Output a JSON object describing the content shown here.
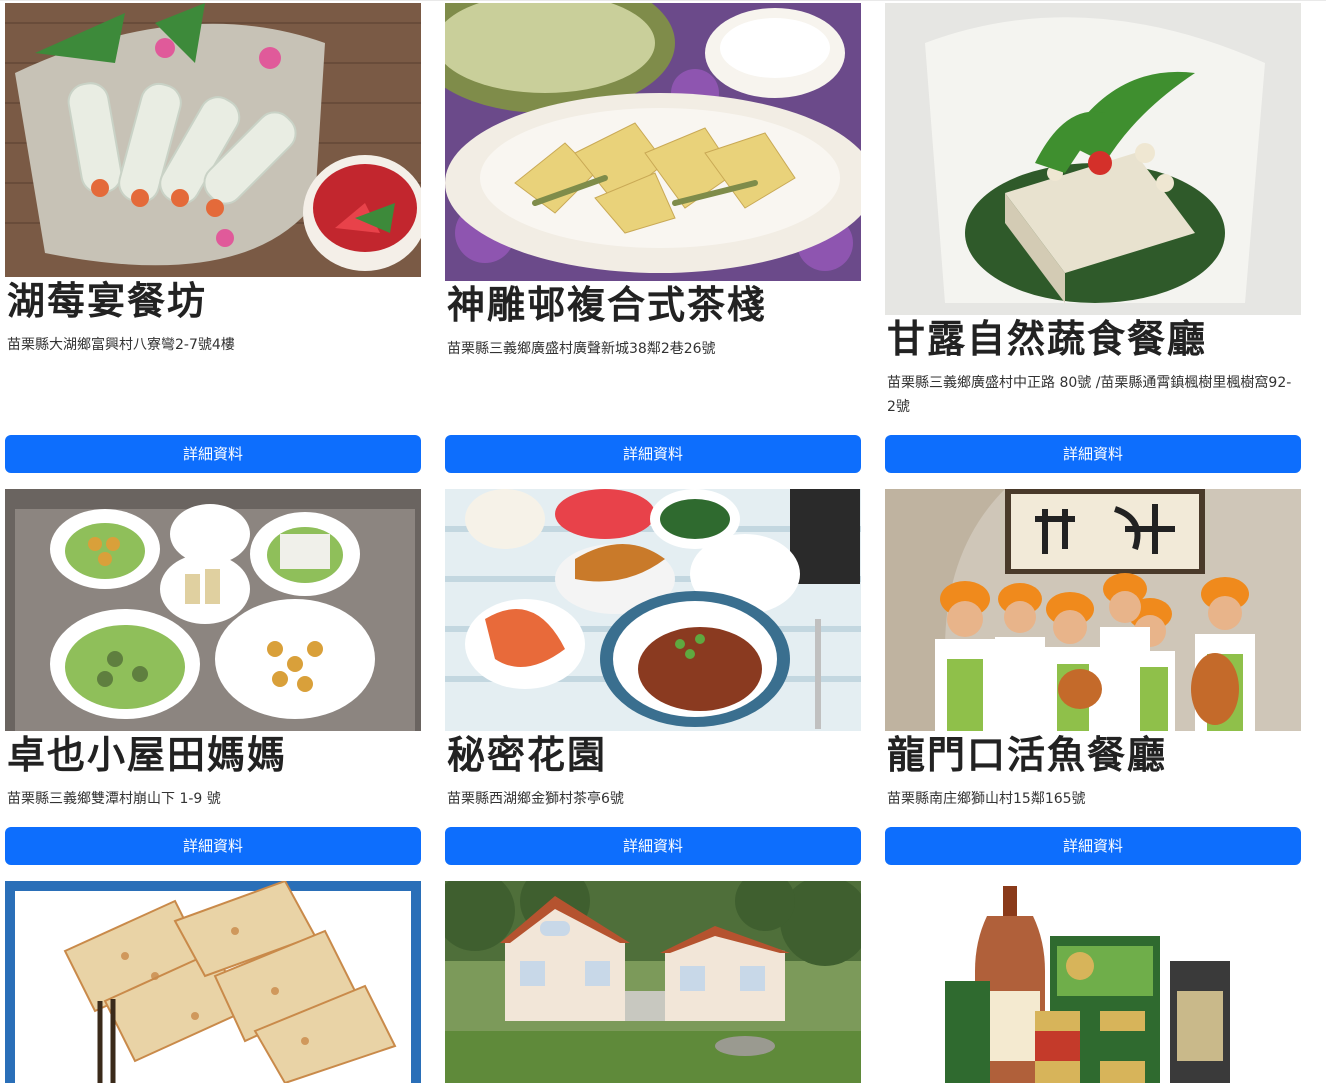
{
  "cards": [
    {
      "name": "湖莓宴餐坊",
      "address": "苗栗縣大湖鄉富興村八寮彎2-7號4樓",
      "button": "詳細資料",
      "image": "shrimp-spring-rolls-photo",
      "palette": [
        "#7a5a45",
        "#c7c2b6",
        "#e9ede3",
        "#e46a3a",
        "#3d8a3a",
        "#c2262e"
      ]
    },
    {
      "name": "神雕邨複合式茶棧",
      "address": "苗栗縣三義鄉廣盛村廣聲新城38鄰2巷26號",
      "button": "詳細資料",
      "image": "bamboo-shoot-salad-photo",
      "palette": [
        "#6b4a8a",
        "#f2ede4",
        "#e9d27a",
        "#7f8c4a",
        "#d8b66a",
        "#9c5ac0"
      ]
    },
    {
      "name": "甘露自然蔬食餐廳",
      "address": "苗栗縣三義鄉廣盛村中正路 80號 /苗栗縣通霄鎮楓樹里楓樹窩92-2號",
      "button": "詳細資料",
      "image": "tofu-dish-photo",
      "palette": [
        "#dcdcdc",
        "#f4f4f0",
        "#2f5a2a",
        "#e8e2cf",
        "#3f8f2f",
        "#d4302a"
      ]
    },
    {
      "name": "卓也小屋田媽媽",
      "address": "苗栗縣三義鄉雙潭村崩山下 1-9 號",
      "button": "詳細資料",
      "image": "vegetarian-banquet-photo",
      "palette": [
        "#6a6460",
        "#ffffff",
        "#8fbf5a",
        "#d9a03a",
        "#5f7f3f",
        "#e0d0a0"
      ]
    },
    {
      "name": "秘密花園",
      "address": "苗栗縣西湖鄉金獅村茶亭6號",
      "button": "詳細資料",
      "image": "set-meal-photo",
      "palette": [
        "#e4eef2",
        "#8a3a20",
        "#e86a3a",
        "#ffffff",
        "#3a6f8f",
        "#2f6a2f"
      ]
    },
    {
      "name": "龍門口活魚餐廳",
      "address": "苗栗縣南庄鄉獅山村15鄰165號",
      "button": "詳細資料",
      "image": "staff-group-photo",
      "palette": [
        "#cfc6b8",
        "#f08a1c",
        "#ffffff",
        "#8fc04a",
        "#c46a2a",
        "#4a3a2a"
      ]
    },
    {
      "name": "",
      "address": "",
      "button": "",
      "image": "radish-cake-photo",
      "palette": [
        "#2a6fb8",
        "#ffffff",
        "#e9d3a6",
        "#c98a4a",
        "#f5ead3",
        "#3a2a1a"
      ]
    },
    {
      "name": "",
      "address": "",
      "button": "",
      "image": "farmhouse-building-photo",
      "palette": [
        "#4f6f3a",
        "#f2e6d8",
        "#b5532f",
        "#7c9a5a",
        "#c8c8c0",
        "#7a8a9a"
      ]
    },
    {
      "name": "",
      "address": "",
      "button": "",
      "image": "products-bottles-photo",
      "palette": [
        "#ffffff",
        "#8a3a1a",
        "#2f6a2f",
        "#d7b45a",
        "#3a3a3a",
        "#c43a2a"
      ]
    }
  ],
  "colors": {
    "button_bg": "#0d6efd",
    "button_text": "#ffffff",
    "title_text": "#222222",
    "address_text": "#333333"
  }
}
